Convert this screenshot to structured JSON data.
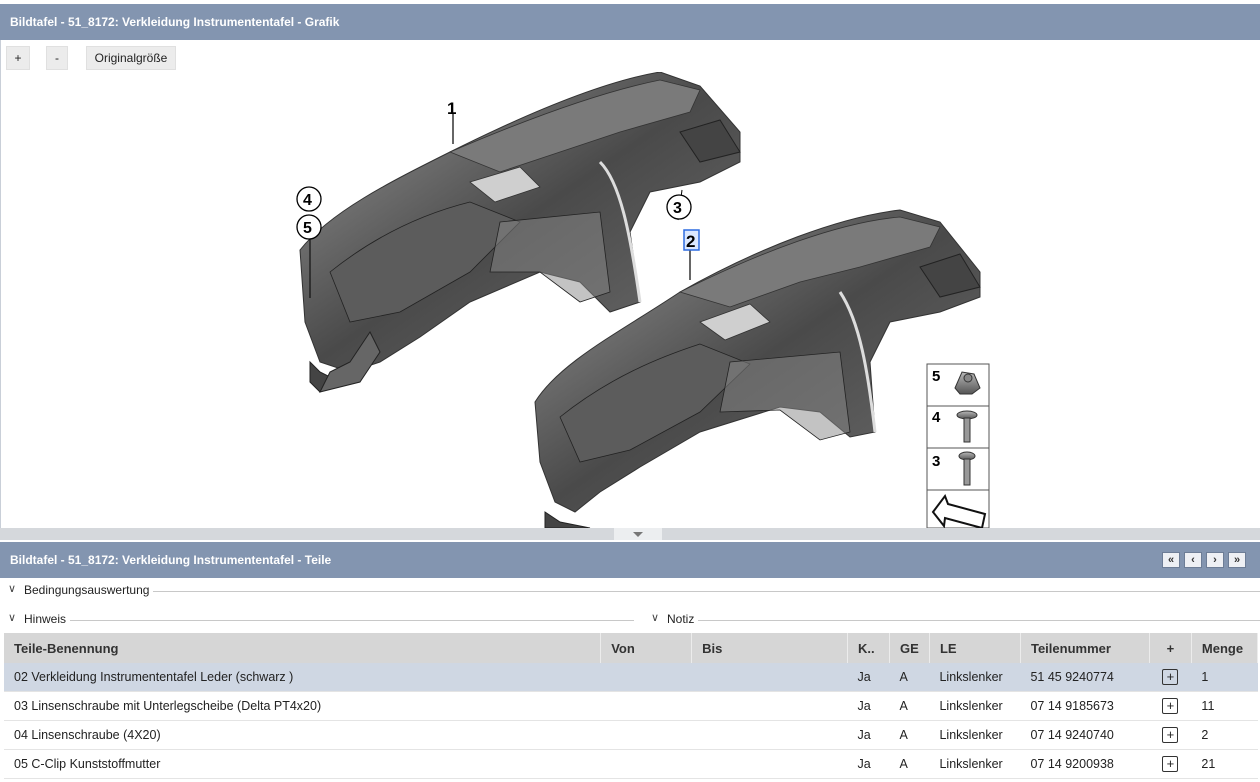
{
  "graphic_panel": {
    "title": "Bildtafel - 51_8172: Verkleidung Instrumententafel - Grafik",
    "zoom_in_label": "+",
    "zoom_out_label": "-",
    "original_size_label": "Originalgröße",
    "callouts": [
      "1",
      "2",
      "3",
      "4",
      "5"
    ],
    "legend_numbers": [
      "5",
      "4",
      "3"
    ]
  },
  "parts_panel": {
    "title": "Bildtafel - 51_8172: Verkleidung Instrumententafel - Teile",
    "pager": {
      "first": "«",
      "prev": "‹",
      "next": "›",
      "last": "»"
    },
    "sections": {
      "conditions": "Bedingungsauswertung",
      "hint": "Hinweis",
      "note": "Notiz"
    },
    "columns": [
      "Teile-Benennung",
      "Von",
      "Bis",
      "K..",
      "GE",
      "LE",
      "Teilenummer",
      "+",
      "Menge"
    ],
    "rows": [
      {
        "name": "02 Verkleidung Instrumententafel Leder (schwarz )",
        "von": "",
        "bis": "",
        "k": "Ja",
        "ge": "A",
        "le": "Linkslenker",
        "number": "51 45 9240774",
        "qty": "1",
        "selected": true
      },
      {
        "name": "03 Linsenschraube mit Unterlegscheibe (Delta PT4x20)",
        "von": "",
        "bis": "",
        "k": "Ja",
        "ge": "A",
        "le": "Linkslenker",
        "number": "07 14 9185673",
        "qty": "11",
        "selected": false
      },
      {
        "name": "04 Linsenschraube (4X20)",
        "von": "",
        "bis": "",
        "k": "Ja",
        "ge": "A",
        "le": "Linkslenker",
        "number": "07 14 9240740",
        "qty": "2",
        "selected": false
      },
      {
        "name": "05 C-Clip Kunststoffmutter",
        "von": "",
        "bis": "",
        "k": "Ja",
        "ge": "A",
        "le": "Linkslenker",
        "number": "07 14 9200938",
        "qty": "21",
        "selected": false
      }
    ]
  },
  "colors": {
    "header": "#8395b0",
    "selected_row": "#cfd7e3",
    "table_header": "#d6d6d6"
  }
}
